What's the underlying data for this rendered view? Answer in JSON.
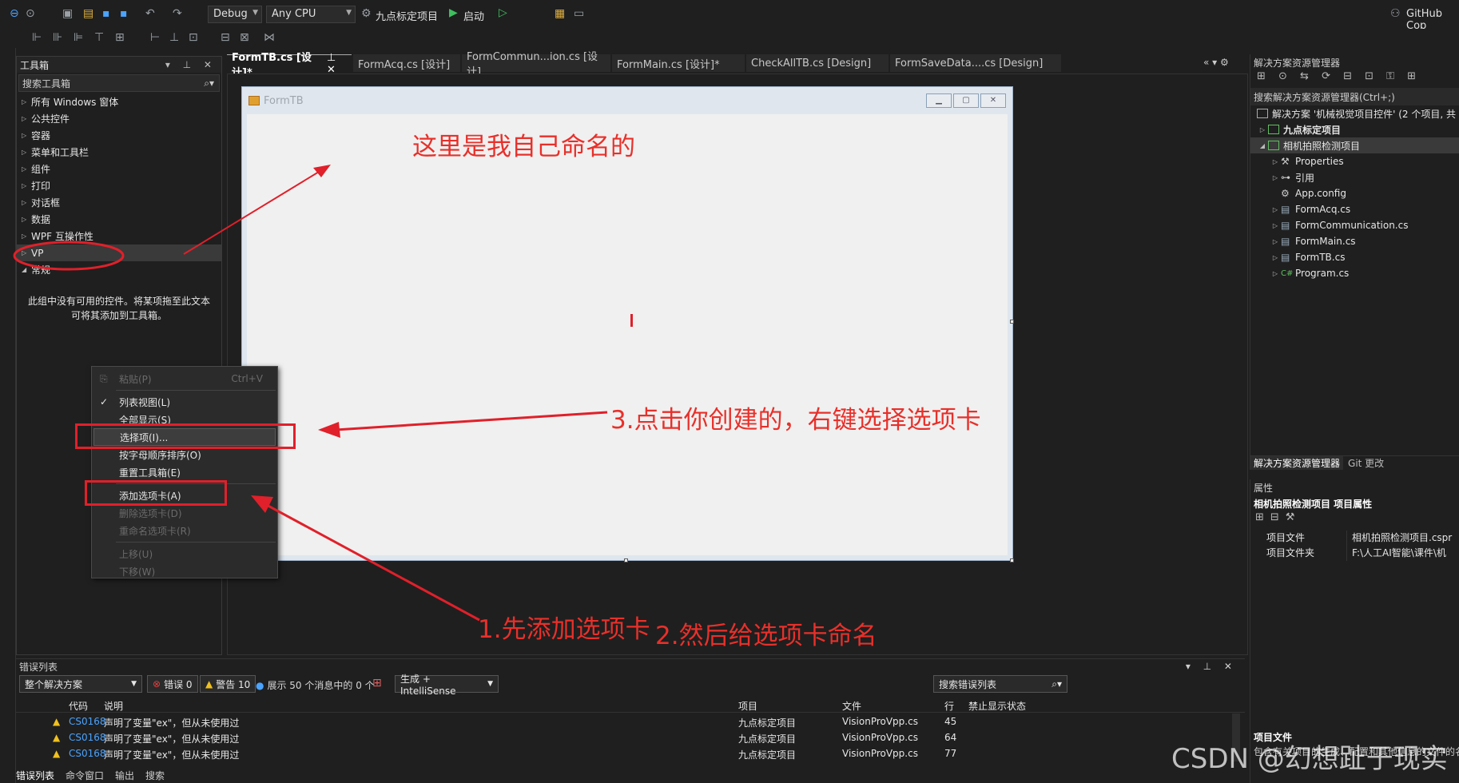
{
  "toolbar": {
    "config": "Debug",
    "platform": "Any CPU",
    "startup_project": "九点标定项目",
    "start_label": "启动",
    "github": "GitHub Cop"
  },
  "toolbox": {
    "title": "工具箱",
    "search_placeholder": "搜索工具箱",
    "items": [
      "所有 Windows 窗体",
      "公共控件",
      "容器",
      "菜单和工具栏",
      "组件",
      "打印",
      "对话框",
      "数据",
      "WPF 互操作性",
      "VP",
      "常规"
    ],
    "empty_text_line1": "此组中没有可用的控件。将某项拖至此文本",
    "empty_text_line2": "可将其添加到工具箱。"
  },
  "context_menu": {
    "paste": "粘贴(P)",
    "paste_shortcut": "Ctrl+V",
    "list_view": "列表视图(L)",
    "show_all": "全部显示(S)",
    "choose_items": "选择项(I)...",
    "sort_alpha": "按字母顺序排序(O)",
    "reset_toolbox": "重置工具箱(E)",
    "add_tab": "添加选项卡(A)",
    "delete_tab": "删除选项卡(D)",
    "rename_tab": "重命名选项卡(R)",
    "move_up": "上移(U)",
    "move_down": "下移(W)"
  },
  "doc_tabs": [
    "FormTB.cs [设计]*",
    "FormAcq.cs [设计]",
    "FormCommun...ion.cs [设计]",
    "FormMain.cs [设计]*",
    "CheckAllTB.cs [Design]",
    "FormSaveData....cs [Design]"
  ],
  "form": {
    "title": "FormTB"
  },
  "solution_explorer": {
    "title": "解决方案资源管理器",
    "search_placeholder": "搜索解决方案资源管理器(Ctrl+;)",
    "solution": "解决方案 '机械视觉项目控件' (2 个项目, 共",
    "project1": "九点标定项目",
    "project2": "相机拍照检测项目",
    "children": [
      "Properties",
      "引用",
      "App.config",
      "FormAcq.cs",
      "FormCommunication.cs",
      "FormMain.cs",
      "FormTB.cs",
      "Program.cs"
    ],
    "tab1": "解决方案资源管理器",
    "tab2": "Git 更改"
  },
  "properties": {
    "title": "属性",
    "object": "相机拍照检测项目  项目属性",
    "rows": [
      {
        "k": "项目文件",
        "v": "相机拍照检测项目.cspr"
      },
      {
        "k": "项目文件夹",
        "v": "F:\\人工AI智能\\课件\\机"
      }
    ],
    "desc_title": "项目文件",
    "desc_text": "包含有关项目的生成、配置和其他信息的文件的名"
  },
  "error_list": {
    "title": "错误列表",
    "scope": "整个解决方案",
    "errors": "错误 0",
    "warnings": "警告 10",
    "messages": "展示 50 个消息中的 0 个",
    "build": "生成 + IntelliSense",
    "search": "搜索错误列表",
    "headers": {
      "code": "代码",
      "desc": "说明",
      "project": "项目",
      "file": "文件",
      "line": "行",
      "suppress": "禁止显示状态"
    },
    "rows": [
      {
        "code": "CS0168",
        "desc": "声明了变量\"ex\"，但从未使用过",
        "project": "九点标定项目",
        "file": "VisionProVpp.cs",
        "line": "45"
      },
      {
        "code": "CS0168",
        "desc": "声明了变量\"ex\"，但从未使用过",
        "project": "九点标定项目",
        "file": "VisionProVpp.cs",
        "line": "64"
      },
      {
        "code": "CS0168",
        "desc": "声明了变量\"ex\"，但从未使用过",
        "project": "九点标定项目",
        "file": "VisionProVpp.cs",
        "line": "77"
      }
    ]
  },
  "bottom_tabs": [
    "错误列表",
    "命令窗口",
    "输出",
    "搜索"
  ],
  "annotations": {
    "a1": "这里是我自己命名的",
    "a2": "3.点击你创建的，右键选择选项卡",
    "a3": "1.先添加选项卡",
    "a4": "2.然后给选项卡命名"
  },
  "watermark": "CSDN @幻想趾于现实",
  "colors": {
    "annotation": "#e8302a",
    "accent": "#4aa3ff",
    "warning": "#f0c020"
  }
}
